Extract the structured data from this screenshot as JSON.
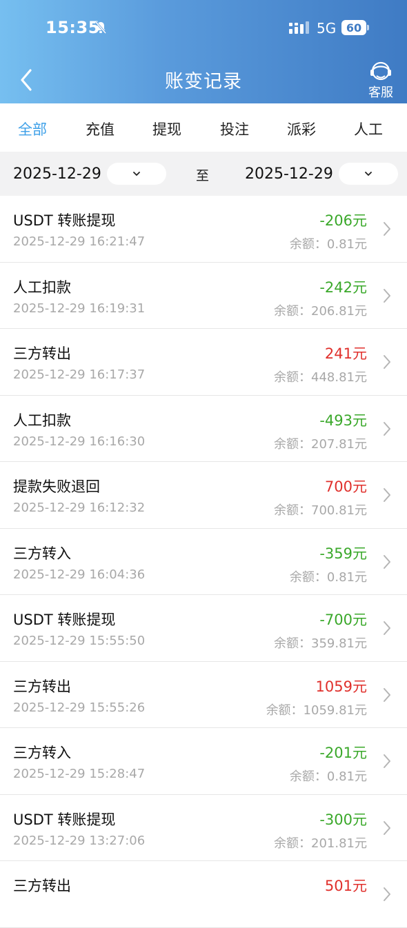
{
  "status": {
    "time": "15:35",
    "network": "5G",
    "battery": "60"
  },
  "header": {
    "title": "账变记录",
    "service_label": "客服"
  },
  "tabs": [
    "全部",
    "充值",
    "提现",
    "投注",
    "派彩",
    "人工"
  ],
  "active_tab": 0,
  "filter": {
    "start_date": "2025-12-29",
    "to_label": "至",
    "end_date": "2025-12-29"
  },
  "balance_prefix": "余额：",
  "records": [
    {
      "title": "USDT 转账提现",
      "time": "2025-12-29 16:21:47",
      "amount": "-206元",
      "balance": "余额：0.81元",
      "type": "neg"
    },
    {
      "title": "人工扣款",
      "time": "2025-12-29 16:19:31",
      "amount": "-242元",
      "balance": "余额：206.81元",
      "type": "neg"
    },
    {
      "title": "三方转出",
      "time": "2025-12-29 16:17:37",
      "amount": "241元",
      "balance": "余额：448.81元",
      "type": "pos"
    },
    {
      "title": "人工扣款",
      "time": "2025-12-29 16:16:30",
      "amount": "-493元",
      "balance": "余额：207.81元",
      "type": "neg"
    },
    {
      "title": "提款失败退回",
      "time": "2025-12-29 16:12:32",
      "amount": "700元",
      "balance": "余额：700.81元",
      "type": "pos"
    },
    {
      "title": "三方转入",
      "time": "2025-12-29 16:04:36",
      "amount": "-359元",
      "balance": "余额：0.81元",
      "type": "neg"
    },
    {
      "title": "USDT 转账提现",
      "time": "2025-12-29 15:55:50",
      "amount": "-700元",
      "balance": "余额：359.81元",
      "type": "neg"
    },
    {
      "title": "三方转出",
      "time": "2025-12-29 15:55:26",
      "amount": "1059元",
      "balance": "余额：1059.81元",
      "type": "pos"
    },
    {
      "title": "三方转入",
      "time": "2025-12-29 15:28:47",
      "amount": "-201元",
      "balance": "余额：0.81元",
      "type": "neg"
    },
    {
      "title": "USDT 转账提现",
      "time": "2025-12-29 13:27:06",
      "amount": "-300元",
      "balance": "余额：201.81元",
      "type": "neg"
    },
    {
      "title": "三方转出",
      "time": "",
      "amount": "501元",
      "balance": "",
      "type": "pos"
    }
  ]
}
